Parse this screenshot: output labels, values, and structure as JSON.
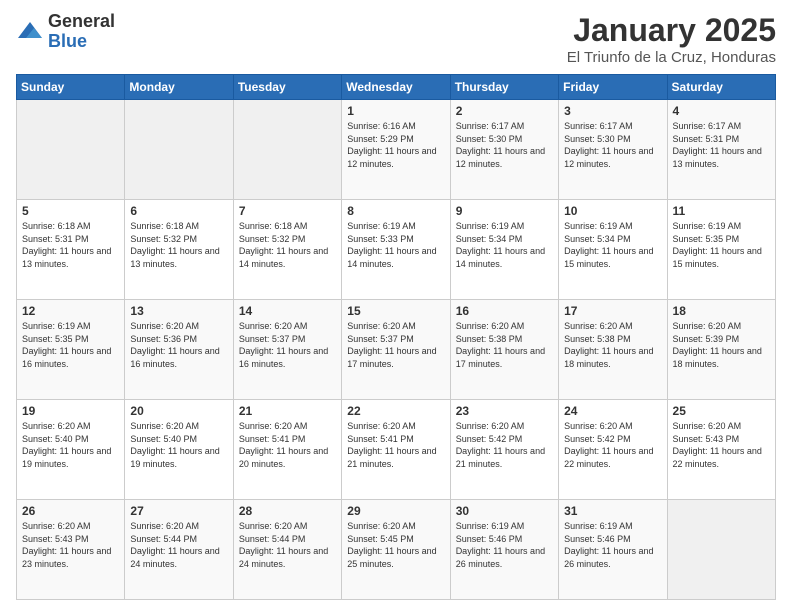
{
  "header": {
    "logo_general": "General",
    "logo_blue": "Blue",
    "month_title": "January 2025",
    "location": "El Triunfo de la Cruz, Honduras"
  },
  "days_of_week": [
    "Sunday",
    "Monday",
    "Tuesday",
    "Wednesday",
    "Thursday",
    "Friday",
    "Saturday"
  ],
  "weeks": [
    [
      {
        "day": "",
        "sunrise": "",
        "sunset": "",
        "daylight": ""
      },
      {
        "day": "",
        "sunrise": "",
        "sunset": "",
        "daylight": ""
      },
      {
        "day": "",
        "sunrise": "",
        "sunset": "",
        "daylight": ""
      },
      {
        "day": "1",
        "sunrise": "Sunrise: 6:16 AM",
        "sunset": "Sunset: 5:29 PM",
        "daylight": "Daylight: 11 hours and 12 minutes."
      },
      {
        "day": "2",
        "sunrise": "Sunrise: 6:17 AM",
        "sunset": "Sunset: 5:30 PM",
        "daylight": "Daylight: 11 hours and 12 minutes."
      },
      {
        "day": "3",
        "sunrise": "Sunrise: 6:17 AM",
        "sunset": "Sunset: 5:30 PM",
        "daylight": "Daylight: 11 hours and 12 minutes."
      },
      {
        "day": "4",
        "sunrise": "Sunrise: 6:17 AM",
        "sunset": "Sunset: 5:31 PM",
        "daylight": "Daylight: 11 hours and 13 minutes."
      }
    ],
    [
      {
        "day": "5",
        "sunrise": "Sunrise: 6:18 AM",
        "sunset": "Sunset: 5:31 PM",
        "daylight": "Daylight: 11 hours and 13 minutes."
      },
      {
        "day": "6",
        "sunrise": "Sunrise: 6:18 AM",
        "sunset": "Sunset: 5:32 PM",
        "daylight": "Daylight: 11 hours and 13 minutes."
      },
      {
        "day": "7",
        "sunrise": "Sunrise: 6:18 AM",
        "sunset": "Sunset: 5:32 PM",
        "daylight": "Daylight: 11 hours and 14 minutes."
      },
      {
        "day": "8",
        "sunrise": "Sunrise: 6:19 AM",
        "sunset": "Sunset: 5:33 PM",
        "daylight": "Daylight: 11 hours and 14 minutes."
      },
      {
        "day": "9",
        "sunrise": "Sunrise: 6:19 AM",
        "sunset": "Sunset: 5:34 PM",
        "daylight": "Daylight: 11 hours and 14 minutes."
      },
      {
        "day": "10",
        "sunrise": "Sunrise: 6:19 AM",
        "sunset": "Sunset: 5:34 PM",
        "daylight": "Daylight: 11 hours and 15 minutes."
      },
      {
        "day": "11",
        "sunrise": "Sunrise: 6:19 AM",
        "sunset": "Sunset: 5:35 PM",
        "daylight": "Daylight: 11 hours and 15 minutes."
      }
    ],
    [
      {
        "day": "12",
        "sunrise": "Sunrise: 6:19 AM",
        "sunset": "Sunset: 5:35 PM",
        "daylight": "Daylight: 11 hours and 16 minutes."
      },
      {
        "day": "13",
        "sunrise": "Sunrise: 6:20 AM",
        "sunset": "Sunset: 5:36 PM",
        "daylight": "Daylight: 11 hours and 16 minutes."
      },
      {
        "day": "14",
        "sunrise": "Sunrise: 6:20 AM",
        "sunset": "Sunset: 5:37 PM",
        "daylight": "Daylight: 11 hours and 16 minutes."
      },
      {
        "day": "15",
        "sunrise": "Sunrise: 6:20 AM",
        "sunset": "Sunset: 5:37 PM",
        "daylight": "Daylight: 11 hours and 17 minutes."
      },
      {
        "day": "16",
        "sunrise": "Sunrise: 6:20 AM",
        "sunset": "Sunset: 5:38 PM",
        "daylight": "Daylight: 11 hours and 17 minutes."
      },
      {
        "day": "17",
        "sunrise": "Sunrise: 6:20 AM",
        "sunset": "Sunset: 5:38 PM",
        "daylight": "Daylight: 11 hours and 18 minutes."
      },
      {
        "day": "18",
        "sunrise": "Sunrise: 6:20 AM",
        "sunset": "Sunset: 5:39 PM",
        "daylight": "Daylight: 11 hours and 18 minutes."
      }
    ],
    [
      {
        "day": "19",
        "sunrise": "Sunrise: 6:20 AM",
        "sunset": "Sunset: 5:40 PM",
        "daylight": "Daylight: 11 hours and 19 minutes."
      },
      {
        "day": "20",
        "sunrise": "Sunrise: 6:20 AM",
        "sunset": "Sunset: 5:40 PM",
        "daylight": "Daylight: 11 hours and 19 minutes."
      },
      {
        "day": "21",
        "sunrise": "Sunrise: 6:20 AM",
        "sunset": "Sunset: 5:41 PM",
        "daylight": "Daylight: 11 hours and 20 minutes."
      },
      {
        "day": "22",
        "sunrise": "Sunrise: 6:20 AM",
        "sunset": "Sunset: 5:41 PM",
        "daylight": "Daylight: 11 hours and 21 minutes."
      },
      {
        "day": "23",
        "sunrise": "Sunrise: 6:20 AM",
        "sunset": "Sunset: 5:42 PM",
        "daylight": "Daylight: 11 hours and 21 minutes."
      },
      {
        "day": "24",
        "sunrise": "Sunrise: 6:20 AM",
        "sunset": "Sunset: 5:42 PM",
        "daylight": "Daylight: 11 hours and 22 minutes."
      },
      {
        "day": "25",
        "sunrise": "Sunrise: 6:20 AM",
        "sunset": "Sunset: 5:43 PM",
        "daylight": "Daylight: 11 hours and 22 minutes."
      }
    ],
    [
      {
        "day": "26",
        "sunrise": "Sunrise: 6:20 AM",
        "sunset": "Sunset: 5:43 PM",
        "daylight": "Daylight: 11 hours and 23 minutes."
      },
      {
        "day": "27",
        "sunrise": "Sunrise: 6:20 AM",
        "sunset": "Sunset: 5:44 PM",
        "daylight": "Daylight: 11 hours and 24 minutes."
      },
      {
        "day": "28",
        "sunrise": "Sunrise: 6:20 AM",
        "sunset": "Sunset: 5:44 PM",
        "daylight": "Daylight: 11 hours and 24 minutes."
      },
      {
        "day": "29",
        "sunrise": "Sunrise: 6:20 AM",
        "sunset": "Sunset: 5:45 PM",
        "daylight": "Daylight: 11 hours and 25 minutes."
      },
      {
        "day": "30",
        "sunrise": "Sunrise: 6:19 AM",
        "sunset": "Sunset: 5:46 PM",
        "daylight": "Daylight: 11 hours and 26 minutes."
      },
      {
        "day": "31",
        "sunrise": "Sunrise: 6:19 AM",
        "sunset": "Sunset: 5:46 PM",
        "daylight": "Daylight: 11 hours and 26 minutes."
      },
      {
        "day": "",
        "sunrise": "",
        "sunset": "",
        "daylight": ""
      }
    ]
  ]
}
